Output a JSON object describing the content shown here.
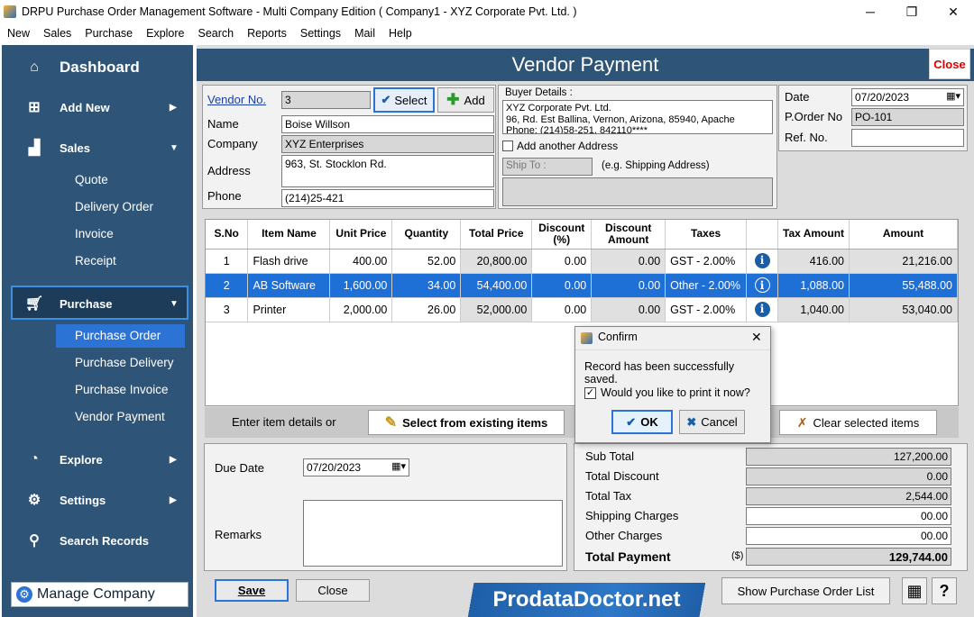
{
  "window": {
    "title": "DRPU Purchase Order Management Software - Multi Company Edition ( Company1 - XYZ Corporate Pvt. Ltd. )",
    "minimize": "─",
    "maximize": "❐",
    "close": "✕"
  },
  "menu": [
    "New",
    "Sales",
    "Purchase",
    "Explore",
    "Search",
    "Reports",
    "Settings",
    "Mail",
    "Help"
  ],
  "sidebar": {
    "dashboard": "Dashboard",
    "add_new": "Add New",
    "sales": "Sales",
    "sales_items": [
      "Quote",
      "Delivery Order",
      "Invoice",
      "Receipt"
    ],
    "purchase": "Purchase",
    "purchase_items": [
      "Purchase Order",
      "Purchase Delivery",
      "Purchase Invoice",
      "Vendor Payment"
    ],
    "explore": "Explore",
    "settings": "Settings",
    "search_records": "Search Records",
    "manage_company": "Manage Company"
  },
  "header": {
    "title": "Vendor Payment",
    "close": "Close"
  },
  "vendor": {
    "vendor_no_label": "Vendor No.",
    "vendor_no": "3",
    "select": "Select",
    "add": "Add",
    "name_label": "Name",
    "name": "Boise Willson",
    "company_label": "Company",
    "company": "XYZ Enterprises",
    "address_label": "Address",
    "address": "963, St. Stocklon Rd.",
    "phone_label": "Phone",
    "phone": "(214)25-421"
  },
  "buyer": {
    "label": "Buyer Details :",
    "line1": "XYZ Corporate Pvt. Ltd.",
    "line2": "96, Rd. Est Ballina, Vernon, Arizona, 85940, Apache",
    "line3": "Phone: (214)58-251, 842110****",
    "add_address": "Add another Address",
    "ship_to": "Ship To :",
    "ship_hint": "(e.g. Shipping Address)"
  },
  "order": {
    "date_label": "Date",
    "date": "07/20/2023",
    "po_label": "P.Order No",
    "po": "PO-101",
    "ref_label": "Ref. No.",
    "ref": ""
  },
  "grid": {
    "headers": [
      "S.No",
      "Item Name",
      "Unit Price",
      "Quantity",
      "Total Price",
      "Discount (%)",
      "Discount Amount",
      "Taxes",
      "",
      "Tax Amount",
      "Amount"
    ],
    "rows": [
      [
        "1",
        "Flash drive",
        "400.00",
        "52.00",
        "20,800.00",
        "0.00",
        "0.00",
        "GST - 2.00%",
        "i",
        "416.00",
        "21,216.00"
      ],
      [
        "2",
        "AB Software",
        "1,600.00",
        "34.00",
        "54,400.00",
        "0.00",
        "0.00",
        "Other - 2.00%",
        "i",
        "1,088.00",
        "55,488.00"
      ],
      [
        "3",
        "Printer",
        "2,000.00",
        "26.00",
        "52,000.00",
        "0.00",
        "0.00",
        "GST - 2.00%",
        "i",
        "1,040.00",
        "53,040.00"
      ]
    ],
    "selected_row": 1
  },
  "bar": {
    "enter_label": "Enter item details or",
    "select_existing": "Select from existing items",
    "clear_selected": "Clear selected items"
  },
  "due": {
    "due_label": "Due Date",
    "due_date": "07/20/2023",
    "remarks_label": "Remarks"
  },
  "totals": {
    "sub_total_label": "Sub Total",
    "sub_total": "127,200.00",
    "total_discount_label": "Total Discount",
    "total_discount": "0.00",
    "total_tax_label": "Total Tax",
    "total_tax": "2,544.00",
    "shipping_label": "Shipping Charges",
    "shipping": "00.00",
    "other_label": "Other Charges",
    "other": "00.00",
    "total_payment_label": "Total Payment",
    "currency": "($)",
    "total_payment": "129,744.00"
  },
  "footer": {
    "save": "Save",
    "close": "Close",
    "logo": "ProdataDoctor.net",
    "show_list": "Show Purchase Order List",
    "help": "?"
  },
  "dialog": {
    "title": "Confirm",
    "message": "Record has been successfully saved.",
    "print_question": "Would you like to print it now?",
    "ok": "OK",
    "cancel": "Cancel",
    "close": "✕"
  }
}
